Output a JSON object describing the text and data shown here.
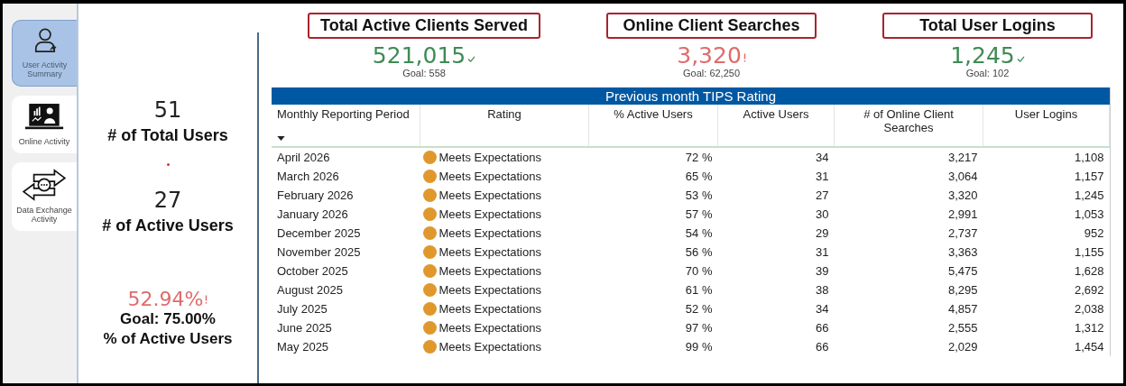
{
  "sidebar": {
    "items": [
      {
        "label": "User Activity Summary",
        "kind": "user",
        "selected": true
      },
      {
        "label": "Online Activity",
        "kind": "laptop",
        "selected": false
      },
      {
        "label": "Data Exchange Activity",
        "kind": "exchange",
        "selected": false
      }
    ]
  },
  "summary": {
    "total_users": {
      "value": "51",
      "label": "# of Total Users"
    },
    "active_users": {
      "value": "27",
      "label": "# of Active Users"
    },
    "active_pct": {
      "value": "52.94%",
      "goal_met": false,
      "goal": "Goal: 75.00%",
      "label": "% of Active Users"
    }
  },
  "kpis": [
    {
      "title": "Total Active Clients Served",
      "value": "521,015",
      "goal_met": true,
      "goal": "Goal: 558"
    },
    {
      "title": "Online Client Searches",
      "value": "3,320",
      "goal_met": false,
      "goal": "Goal: 62,250"
    },
    {
      "title": "Total User Logins",
      "value": "1,245",
      "goal_met": true,
      "goal": "Goal: 102"
    }
  ],
  "table": {
    "title": "Previous month TIPS Rating",
    "columns": [
      "Monthly Reporting Period",
      "Rating",
      "% Active Users",
      "Active Users",
      "# of Online Client Searches",
      "User Logins"
    ],
    "rows": [
      {
        "cells": [
          "April 2026",
          "Meets Expectations",
          "72 %",
          "34",
          "3,217",
          "1,108"
        ],
        "color": "#e0982c"
      },
      {
        "cells": [
          "March 2026",
          "Meets Expectations",
          "65 %",
          "31",
          "3,064",
          "1,157"
        ],
        "color": "#e0982c"
      },
      {
        "cells": [
          "February 2026",
          "Meets Expectations",
          "53 %",
          "27",
          "3,320",
          "1,245"
        ],
        "color": "#e0982c"
      },
      {
        "cells": [
          "January 2026",
          "Meets Expectations",
          "57 %",
          "30",
          "2,991",
          "1,053"
        ],
        "color": "#e0982c"
      },
      {
        "cells": [
          "December 2025",
          "Meets Expectations",
          "54 %",
          "29",
          "2,737",
          "952"
        ],
        "color": "#e0982c"
      },
      {
        "cells": [
          "November 2025",
          "Meets Expectations",
          "56 %",
          "31",
          "3,363",
          "1,155"
        ],
        "color": "#e0982c"
      },
      {
        "cells": [
          "October 2025",
          "Meets Expectations",
          "70 %",
          "39",
          "5,475",
          "1,628"
        ],
        "color": "#e0982c"
      },
      {
        "cells": [
          "August 2025",
          "Meets Expectations",
          "61 %",
          "38",
          "8,295",
          "2,692"
        ],
        "color": "#e0982c"
      },
      {
        "cells": [
          "July 2025",
          "Meets Expectations",
          "52 %",
          "34",
          "4,857",
          "2,038"
        ],
        "color": "#e0982c"
      },
      {
        "cells": [
          "June 2025",
          "Meets Expectations",
          "97 %",
          "66",
          "2,555",
          "1,312"
        ],
        "color": "#e0982c"
      },
      {
        "cells": [
          "May 2025",
          "Meets Expectations",
          "99 %",
          "66",
          "2,029",
          "1,454"
        ],
        "color": "#e0982c"
      }
    ]
  }
}
